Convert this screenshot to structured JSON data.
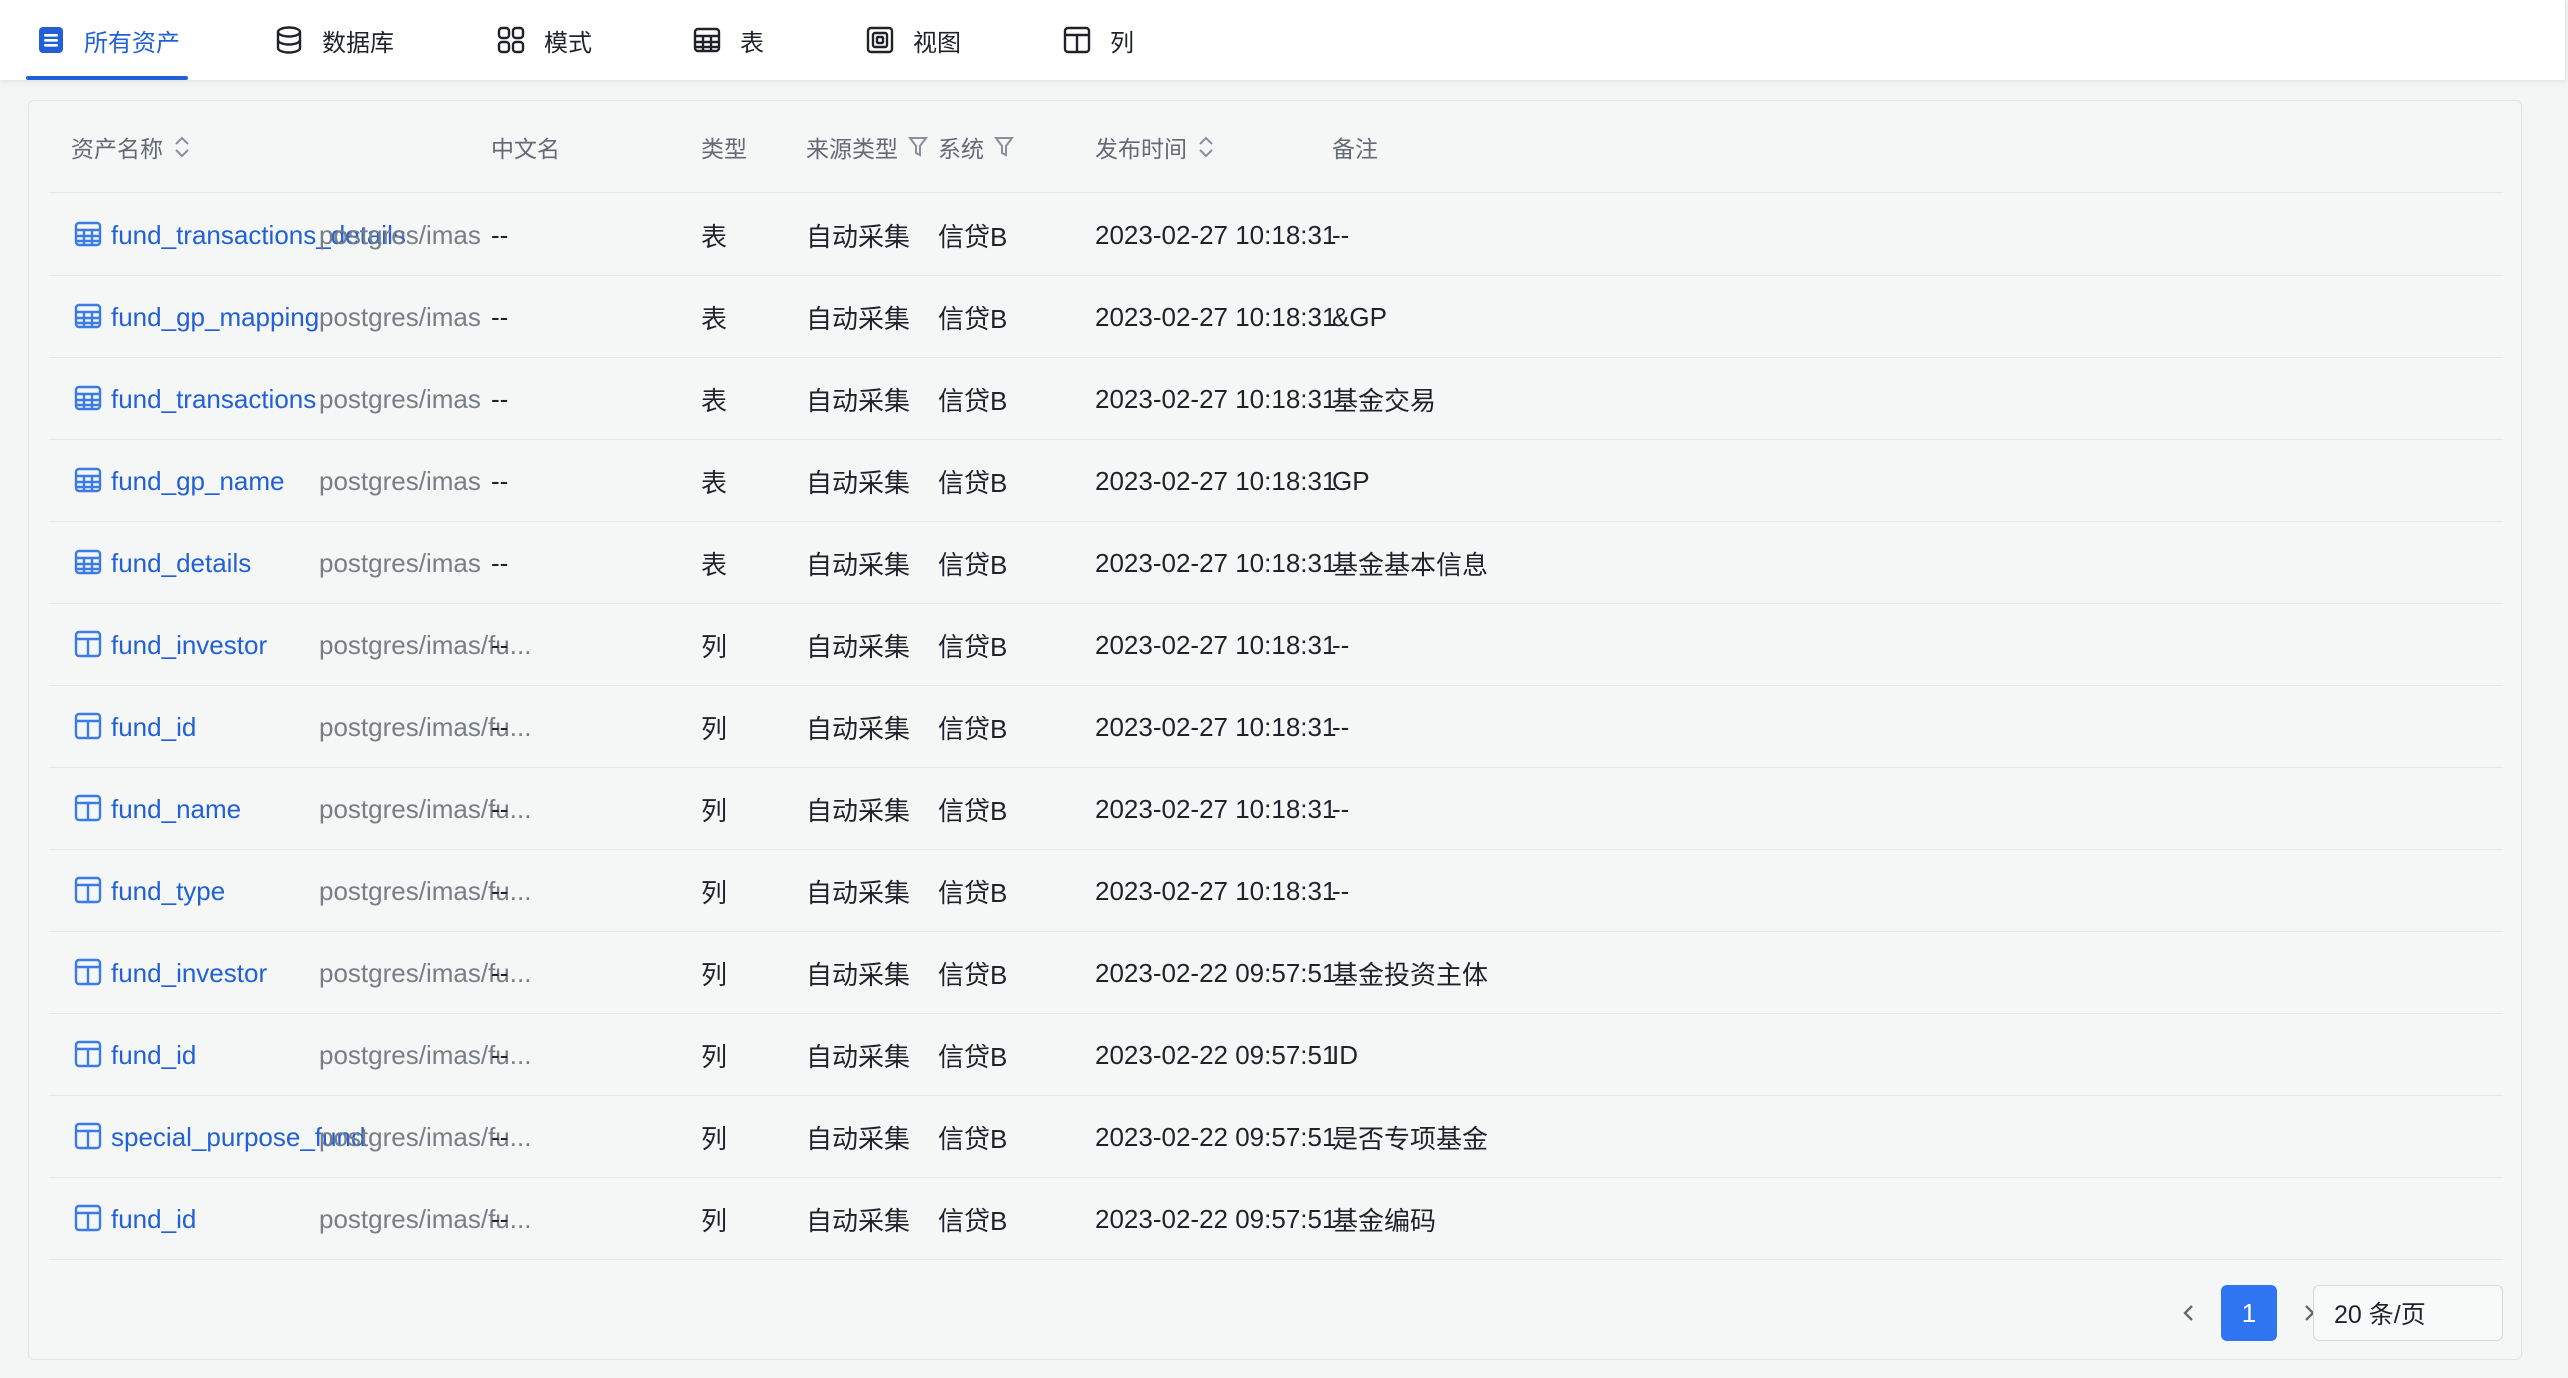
{
  "tabs": [
    {
      "label": "所有资产",
      "icon": "document-list-icon",
      "active": true
    },
    {
      "label": "数据库",
      "icon": "database-icon",
      "active": false
    },
    {
      "label": "模式",
      "icon": "schema-grid-icon",
      "active": false
    },
    {
      "label": "表",
      "icon": "table-icon",
      "active": false
    },
    {
      "label": "视图",
      "icon": "view-icon",
      "active": false
    },
    {
      "label": "列",
      "icon": "column-icon",
      "active": false
    }
  ],
  "columns": {
    "asset_name": "资产名称",
    "chinese_name": "中文名",
    "type": "类型",
    "source_type": "来源类型",
    "system": "系统",
    "publish_time": "发布时间",
    "remark": "备注"
  },
  "rows": [
    {
      "icon": "table-icon",
      "name": "fund_transactions_details",
      "path": "postgres/imas",
      "cn_name": "--",
      "type": "表",
      "source": "自动采集",
      "system": "信贷B",
      "time": "2023-02-27 10:18:31",
      "remark": "--"
    },
    {
      "icon": "table-icon",
      "name": "fund_gp_mapping",
      "path": "postgres/imas",
      "cn_name": "--",
      "type": "表",
      "source": "自动采集",
      "system": "信贷B",
      "time": "2023-02-27 10:18:31",
      "remark": "&GP"
    },
    {
      "icon": "table-icon",
      "name": "fund_transactions",
      "path": "postgres/imas",
      "cn_name": "--",
      "type": "表",
      "source": "自动采集",
      "system": "信贷B",
      "time": "2023-02-27 10:18:31",
      "remark": "基金交易"
    },
    {
      "icon": "table-icon",
      "name": "fund_gp_name",
      "path": "postgres/imas",
      "cn_name": "--",
      "type": "表",
      "source": "自动采集",
      "system": "信贷B",
      "time": "2023-02-27 10:18:31",
      "remark": "GP"
    },
    {
      "icon": "table-icon",
      "name": "fund_details",
      "path": "postgres/imas",
      "cn_name": "--",
      "type": "表",
      "source": "自动采集",
      "system": "信贷B",
      "time": "2023-02-27 10:18:31",
      "remark": "基金基本信息"
    },
    {
      "icon": "column-icon",
      "name": "fund_investor",
      "path": "postgres/imas/fu...",
      "cn_name": "--",
      "type": "列",
      "source": "自动采集",
      "system": "信贷B",
      "time": "2023-02-27 10:18:31",
      "remark": "--"
    },
    {
      "icon": "column-icon",
      "name": "fund_id",
      "path": "postgres/imas/fu...",
      "cn_name": "--",
      "type": "列",
      "source": "自动采集",
      "system": "信贷B",
      "time": "2023-02-27 10:18:31",
      "remark": "--"
    },
    {
      "icon": "column-icon",
      "name": "fund_name",
      "path": "postgres/imas/fu...",
      "cn_name": "--",
      "type": "列",
      "source": "自动采集",
      "system": "信贷B",
      "time": "2023-02-27 10:18:31",
      "remark": "--"
    },
    {
      "icon": "column-icon",
      "name": "fund_type",
      "path": "postgres/imas/fu...",
      "cn_name": "--",
      "type": "列",
      "source": "自动采集",
      "system": "信贷B",
      "time": "2023-02-27 10:18:31",
      "remark": "--"
    },
    {
      "icon": "column-icon",
      "name": "fund_investor",
      "path": "postgres/imas/fu...",
      "cn_name": "--",
      "type": "列",
      "source": "自动采集",
      "system": "信贷B",
      "time": "2023-02-22 09:57:51",
      "remark": "基金投资主体"
    },
    {
      "icon": "column-icon",
      "name": "fund_id",
      "path": "postgres/imas/fu...",
      "cn_name": "--",
      "type": "列",
      "source": "自动采集",
      "system": "信贷B",
      "time": "2023-02-22 09:57:51",
      "remark": "ID"
    },
    {
      "icon": "column-icon",
      "name": "special_purpose_fund",
      "path": "postgres/imas/fu...",
      "cn_name": "--",
      "type": "列",
      "source": "自动采集",
      "system": "信贷B",
      "time": "2023-02-22 09:57:51",
      "remark": "是否专项基金"
    },
    {
      "icon": "column-icon",
      "name": "fund_id",
      "path": "postgres/imas/fu...",
      "cn_name": "--",
      "type": "列",
      "source": "自动采集",
      "system": "信贷B",
      "time": "2023-02-22 09:57:51",
      "remark": "基金编码"
    }
  ],
  "pagination": {
    "current_page": "1",
    "page_size": "20 条/页"
  },
  "colors": {
    "accent": "#2160d7",
    "pager_active": "#2f74f0",
    "row_icon": "#3b7be8"
  }
}
